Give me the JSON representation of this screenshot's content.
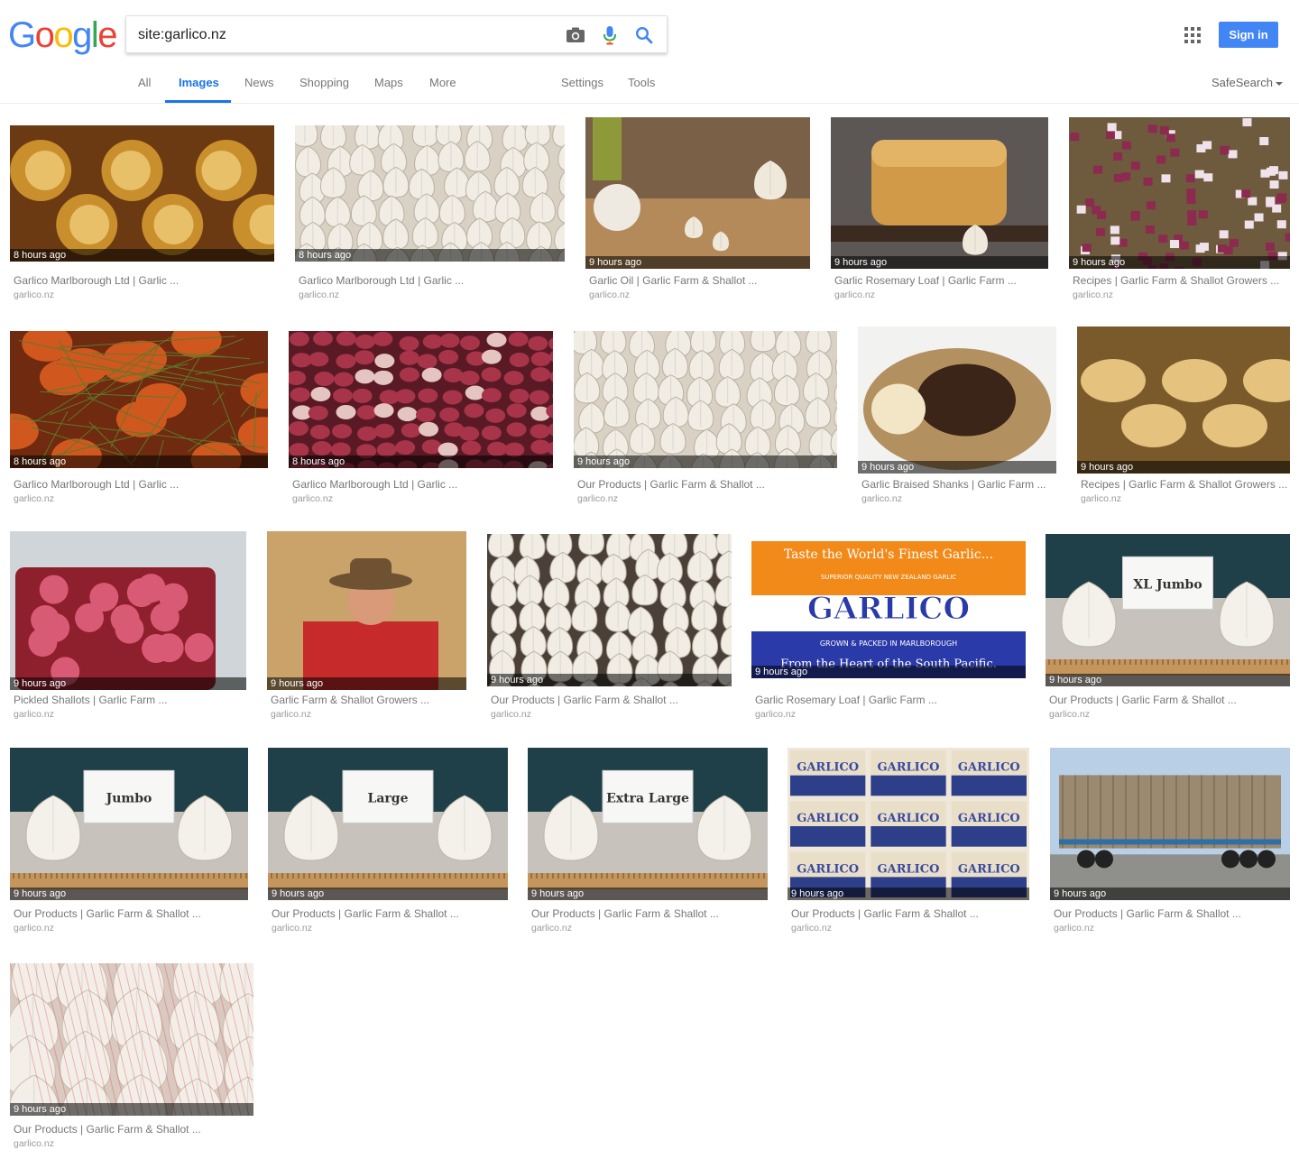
{
  "logo": {
    "letters": [
      {
        "ch": "G",
        "color": "#4285f4"
      },
      {
        "ch": "o",
        "color": "#ea4335"
      },
      {
        "ch": "o",
        "color": "#fbbc05"
      },
      {
        "ch": "g",
        "color": "#4285f4"
      },
      {
        "ch": "l",
        "color": "#34a853"
      },
      {
        "ch": "e",
        "color": "#ea4335"
      }
    ]
  },
  "search": {
    "value": "site:garlico.nz"
  },
  "header": {
    "sign_in": "Sign in",
    "safesearch": "SafeSearch"
  },
  "tabs": [
    {
      "label": "All"
    },
    {
      "label": "Images",
      "active": true
    },
    {
      "label": "News"
    },
    {
      "label": "Shopping"
    },
    {
      "label": "Maps"
    },
    {
      "label": "More"
    },
    {
      "label": "Settings"
    },
    {
      "label": "Tools"
    }
  ],
  "results": [
    {
      "title": "Garlico Marlborough Ltd | Garlic ...",
      "site": "garlico.nz",
      "age": "8 hours ago",
      "image": "roasted-garlic"
    },
    {
      "title": "Garlico Marlborough Ltd | Garlic ...",
      "site": "garlico.nz",
      "age": "8 hours ago",
      "image": "garlic-bulbs"
    },
    {
      "title": "Garlic Oil | Garlic Farm & Shallot ...",
      "site": "garlico.nz",
      "age": "9 hours ago",
      "image": "garlic-oil"
    },
    {
      "title": "Garlic Rosemary Loaf | Garlic Farm ...",
      "site": "garlico.nz",
      "age": "9 hours ago",
      "image": "rosemary-loaf"
    },
    {
      "title": "Recipes | Garlic Farm & Shallot Growers ...",
      "site": "garlico.nz",
      "age": "9 hours ago",
      "image": "diced-shallots"
    },
    {
      "title": "Garlico Marlborough Ltd | Garlic ...",
      "site": "garlico.nz",
      "age": "8 hours ago",
      "image": "roasted-shallots"
    },
    {
      "title": "Garlico Marlborough Ltd | Garlic ...",
      "site": "garlico.nz",
      "age": "8 hours ago",
      "image": "red-shallots"
    },
    {
      "title": "Our Products | Garlic Farm & Shallot ...",
      "site": "garlico.nz",
      "age": "9 hours ago",
      "image": "garlic-pile"
    },
    {
      "title": "Garlic Braised Shanks | Garlic Farm ...",
      "site": "garlico.nz",
      "age": "9 hours ago",
      "image": "braised-shanks"
    },
    {
      "title": "Recipes | Garlic Farm & Shallot Growers ...",
      "site": "garlico.nz",
      "age": "9 hours ago",
      "image": "garlic-chicken"
    },
    {
      "title": "Pickled Shallots | Garlic Farm ...",
      "site": "garlico.nz",
      "age": "9 hours ago",
      "image": "pickled-shallots"
    },
    {
      "title": "Garlic Farm & Shallot Growers ...",
      "site": "garlico.nz",
      "age": "9 hours ago",
      "image": "farmer"
    },
    {
      "title": "Our Products | Garlic Farm & Shallot ...",
      "site": "garlico.nz",
      "age": "9 hours ago",
      "image": "garlic-box"
    },
    {
      "title": "Garlic Rosemary Loaf | Garlic Farm ...",
      "site": "garlico.nz",
      "age": "9 hours ago",
      "image": "garlico-logo",
      "logo_text": {
        "top": "Taste the World's Finest Garlic...",
        "arc": "SUPERIOR QUALITY NEW ZEALAND GARLIC",
        "brand": "GARLICO",
        "packed": "GROWN & PACKED IN MARLBOROUGH",
        "bottom": "From the Heart of the South Pacific."
      }
    },
    {
      "title": "Our Products | Garlic Farm & Shallot ...",
      "site": "garlico.nz",
      "age": "9 hours ago",
      "image": "sign-bulbs",
      "sign": "XL Jumbo"
    },
    {
      "title": "Our Products | Garlic Farm & Shallot ...",
      "site": "garlico.nz",
      "age": "9 hours ago",
      "image": "sign-bulbs",
      "sign": "Jumbo"
    },
    {
      "title": "Our Products | Garlic Farm & Shallot ...",
      "site": "garlico.nz",
      "age": "9 hours ago",
      "image": "sign-bulbs",
      "sign": "Large"
    },
    {
      "title": "Our Products | Garlic Farm & Shallot ...",
      "site": "garlico.nz",
      "age": "9 hours ago",
      "image": "sign-bulbs",
      "sign": "Extra Large"
    },
    {
      "title": "Our Products | Garlic Farm & Shallot ...",
      "site": "garlico.nz",
      "age": "9 hours ago",
      "image": "garlico-boxes",
      "box_label": "GARLICO"
    },
    {
      "title": "Our Products | Garlic Farm & Shallot ...",
      "site": "garlico.nz",
      "age": "9 hours ago",
      "image": "truck"
    },
    {
      "title": "Our Products | Garlic Farm & Shallot ...",
      "site": "garlico.nz",
      "age": "9 hours ago",
      "image": "garlic-net"
    }
  ],
  "colors": {
    "accent": "#1a73e8",
    "signin": "#4285f4"
  }
}
